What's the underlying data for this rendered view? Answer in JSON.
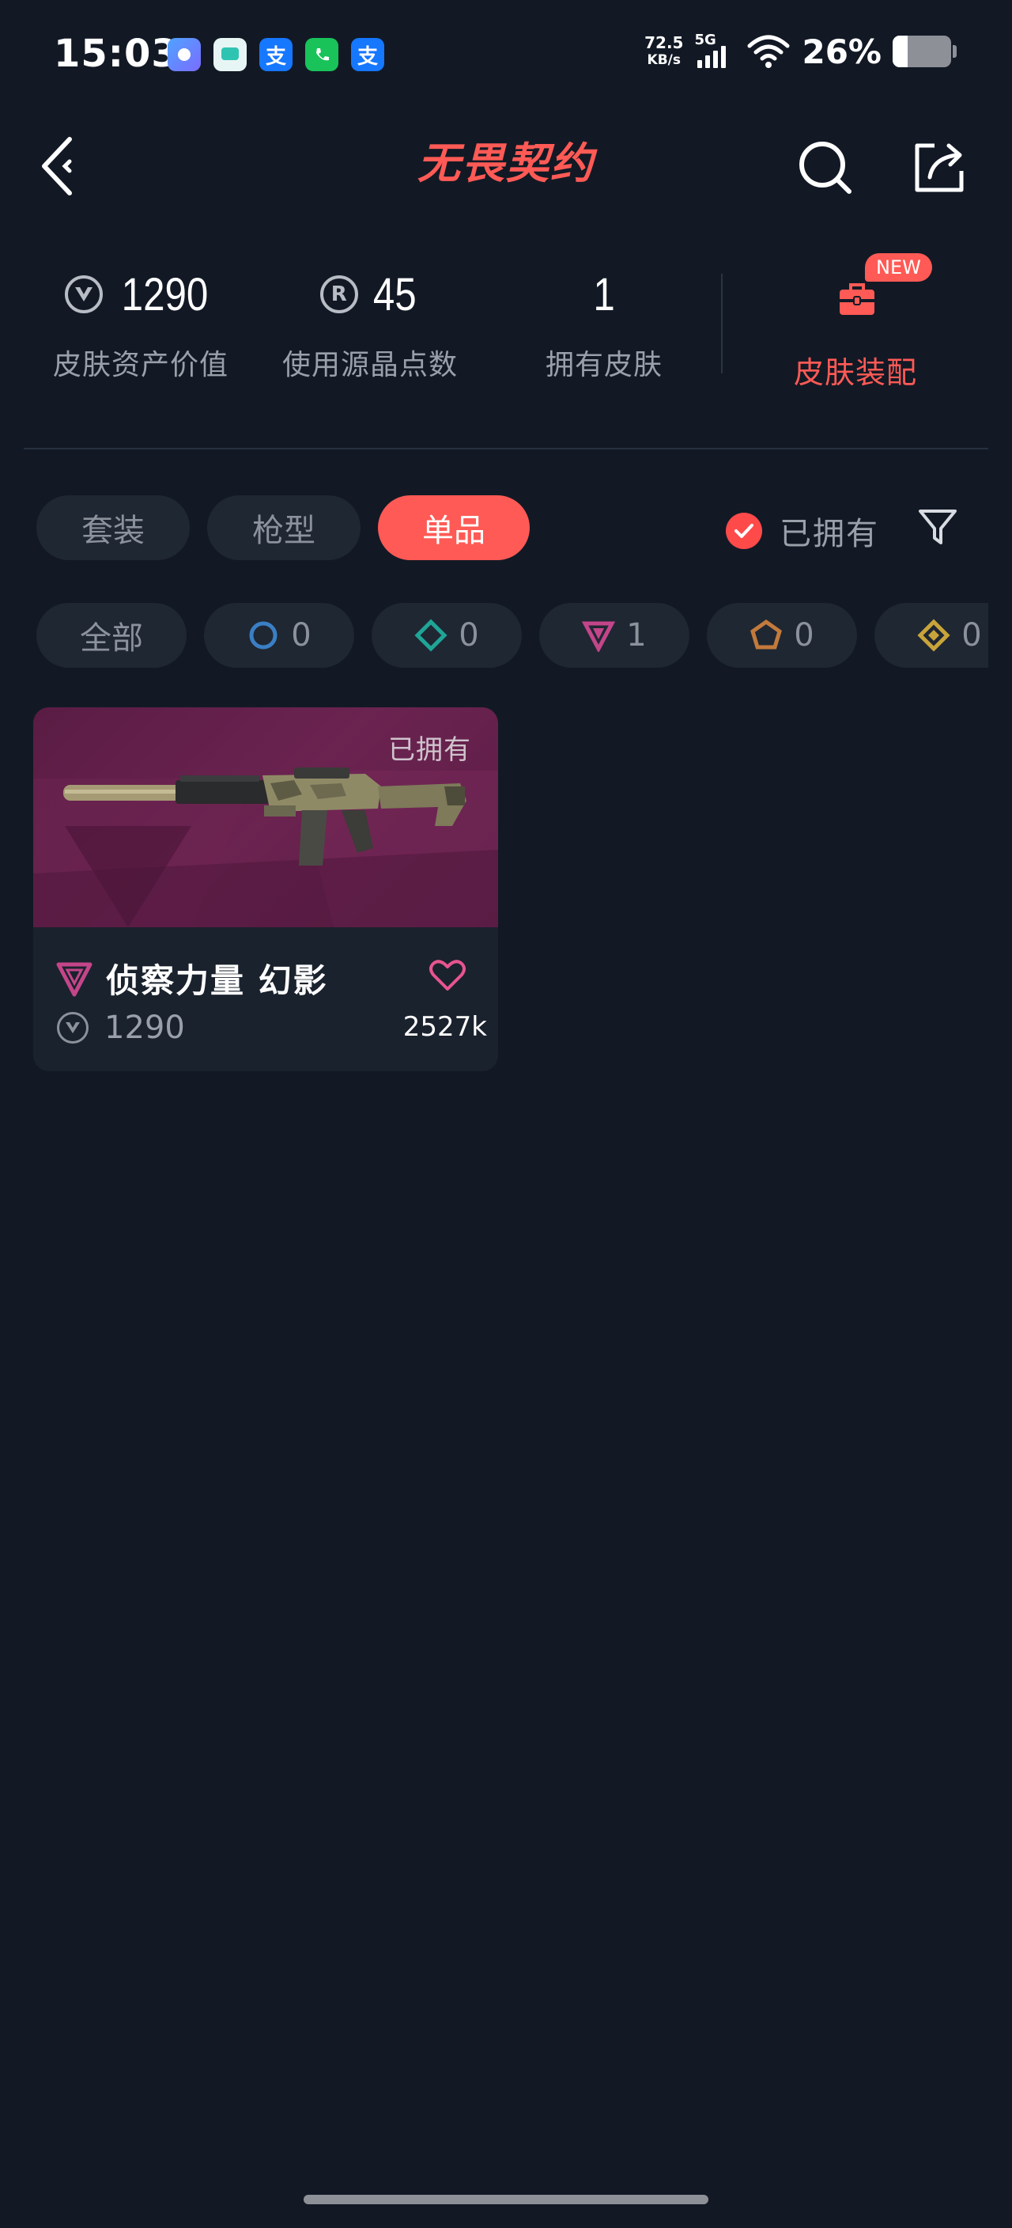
{
  "status_bar": {
    "time": "15:03",
    "net_speed_value": "72.5",
    "net_speed_unit": "KB/s",
    "network": "5G",
    "battery_pct": "26%",
    "battery_level": 0.26,
    "notification_icons": [
      "video-app-icon",
      "msg-app-icon",
      "alipay-icon",
      "phone-app-icon",
      "alipay-icon"
    ]
  },
  "header": {
    "title": "无畏契约"
  },
  "stats": [
    {
      "value": "1290",
      "label": "皮肤资产价值",
      "icon": "vp-icon"
    },
    {
      "value": "45",
      "label": "使用源晶点数",
      "icon": "radianite-icon",
      "icon_text": "R"
    },
    {
      "value": "1",
      "label": "拥有皮肤"
    }
  ],
  "equip": {
    "badge": "NEW",
    "label": "皮肤装配"
  },
  "tabs": [
    {
      "label": "套装",
      "active": false
    },
    {
      "label": "枪型",
      "active": false
    },
    {
      "label": "单品",
      "active": true
    }
  ],
  "owned_filter": {
    "label": "已拥有",
    "checked": true
  },
  "rarity_chips": [
    {
      "label": "全部"
    },
    {
      "count": "0",
      "icon": "select-tier-icon",
      "color": "#3a7fc4"
    },
    {
      "count": "0",
      "icon": "deluxe-tier-icon",
      "color": "#1fa596"
    },
    {
      "count": "1",
      "icon": "premium-tier-icon",
      "color": "#c4458a"
    },
    {
      "count": "0",
      "icon": "ultra-tier-icon",
      "color": "#c27a3c"
    },
    {
      "count": "0",
      "icon": "exclusive-tier-icon",
      "color": "#c9a43a"
    }
  ],
  "cards": [
    {
      "owned_label": "已拥有",
      "name": "侦察力量 幻影",
      "price": "1290",
      "likes": "2527k",
      "rarity": "premium-tier-icon"
    }
  ],
  "colors": {
    "background": "#121925",
    "accent": "#ff5a55",
    "chip_bg": "#1f2733"
  }
}
